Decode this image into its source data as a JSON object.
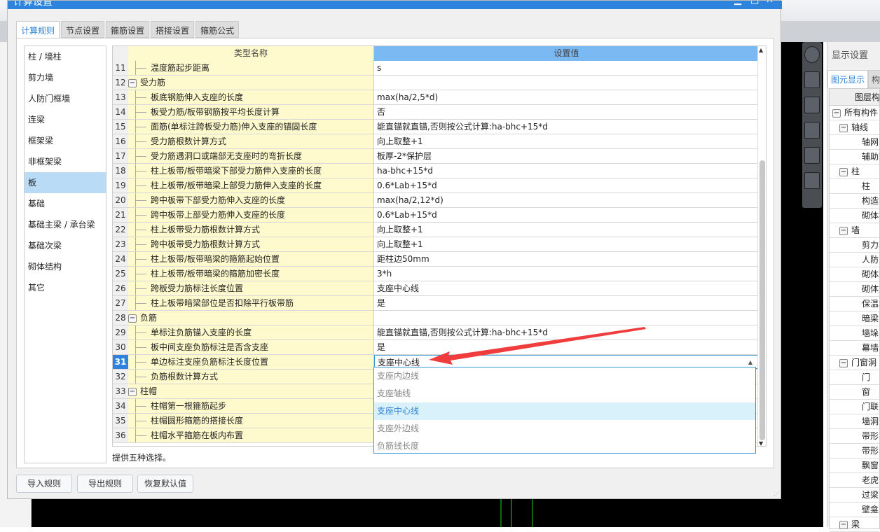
{
  "dialog": {
    "title": "计算设置",
    "tabs": [
      "计算规则",
      "节点设置",
      "箍筋设置",
      "搭接设置",
      "箍筋公式"
    ],
    "active_tab": 0
  },
  "categories": [
    "柱 / 墙柱",
    "剪力墙",
    "人防门框墙",
    "连梁",
    "框架梁",
    "非框架梁",
    "板",
    "基础",
    "基础主梁 / 承台梁",
    "基础次梁",
    "砌体结构",
    "其它"
  ],
  "selected_category": "板",
  "grid": {
    "headers": {
      "name": "类型名称",
      "value": "设置值"
    },
    "rows": [
      {
        "num": "11",
        "name": "温度筋起步距离",
        "value": "s",
        "type": "child"
      },
      {
        "num": "12",
        "name": "受力筋",
        "value": "",
        "type": "group"
      },
      {
        "num": "13",
        "name": "板底钢筋伸入支座的长度",
        "value": "max(ha/2,5*d)",
        "type": "child"
      },
      {
        "num": "14",
        "name": "板受力筋/板带钢筋按平均长度计算",
        "value": "否",
        "type": "child"
      },
      {
        "num": "15",
        "name": "面筋(单标注跨板受力筋)伸入支座的锚固长度",
        "value": "能直锚就直锚,否则按公式计算:ha-bhc+15*d",
        "type": "child"
      },
      {
        "num": "16",
        "name": "受力筋根数计算方式",
        "value": "向上取整+1",
        "type": "child"
      },
      {
        "num": "17",
        "name": "受力筋遇洞口或端部无支座时的弯折长度",
        "value": "板厚-2*保护层",
        "type": "child"
      },
      {
        "num": "18",
        "name": "柱上板带/板带暗梁下部受力筋伸入支座的长度",
        "value": "ha-bhc+15*d",
        "type": "child"
      },
      {
        "num": "19",
        "name": "柱上板带/板带暗梁上部受力筋伸入支座的长度",
        "value": "0.6*Lab+15*d",
        "type": "child"
      },
      {
        "num": "20",
        "name": "跨中板带下部受力筋伸入支座的长度",
        "value": "max(ha/2,12*d)",
        "type": "child"
      },
      {
        "num": "21",
        "name": "跨中板带上部受力筋伸入支座的长度",
        "value": "0.6*Lab+15*d",
        "type": "child"
      },
      {
        "num": "22",
        "name": "柱上板带受力筋根数计算方式",
        "value": "向上取整+1",
        "type": "child"
      },
      {
        "num": "23",
        "name": "跨中板带受力筋根数计算方式",
        "value": "向上取整+1",
        "type": "child"
      },
      {
        "num": "24",
        "name": "柱上板带/板带暗梁的箍筋起始位置",
        "value": "距柱边50mm",
        "type": "child"
      },
      {
        "num": "25",
        "name": "柱上板带/板带暗梁的箍筋加密长度",
        "value": "3*h",
        "type": "child"
      },
      {
        "num": "26",
        "name": "跨板受力筋标注长度位置",
        "value": "支座中心线",
        "type": "child"
      },
      {
        "num": "27",
        "name": "柱上板带暗梁部位是否扣除平行板带筋",
        "value": "是",
        "type": "child"
      },
      {
        "num": "28",
        "name": "负筋",
        "value": "",
        "type": "group"
      },
      {
        "num": "29",
        "name": "单标注负筋锚入支座的长度",
        "value": "能直锚就直锚,否则按公式计算:ha-bhc+15*d",
        "type": "child"
      },
      {
        "num": "30",
        "name": "板中间支座负筋标注是否含支座",
        "value": "是",
        "type": "child"
      },
      {
        "num": "31",
        "name": "单边标注支座负筋标注长度位置",
        "value": "支座中心线",
        "type": "child",
        "selected": true
      },
      {
        "num": "32",
        "name": "负筋根数计算方式",
        "value": "",
        "type": "child"
      },
      {
        "num": "33",
        "name": "柱帽",
        "value": "",
        "type": "group"
      },
      {
        "num": "34",
        "name": "柱帽第一根箍筋起步",
        "value": "",
        "type": "child"
      },
      {
        "num": "35",
        "name": "柱帽圆形箍筋的搭接长度",
        "value": "",
        "type": "child"
      },
      {
        "num": "36",
        "name": "柱帽水平箍筋在板内布置",
        "value": "",
        "type": "child"
      }
    ]
  },
  "dropdown": {
    "options": [
      "支座内边线",
      "支座轴线",
      "支座中心线",
      "支座外边线",
      "负筋线长度"
    ],
    "selected": "支座中心线"
  },
  "hint": "提供五种选择。",
  "buttons": {
    "import": "导入规则",
    "export": "导出规则",
    "reset": "恢复默认值"
  },
  "right_panel": {
    "title": "显示设置",
    "tabs": [
      "图元显示",
      "构"
    ],
    "header": "图层构件",
    "tree": [
      {
        "label": "所有构件",
        "level": 0,
        "group": true
      },
      {
        "label": "轴线",
        "level": 1,
        "group": true
      },
      {
        "label": "轴网",
        "level": 2
      },
      {
        "label": "辅助轴线",
        "level": 2
      },
      {
        "label": "柱",
        "level": 1,
        "group": true
      },
      {
        "label": "柱",
        "level": 2
      },
      {
        "label": "构造柱",
        "level": 2
      },
      {
        "label": "砌体柱",
        "level": 2
      },
      {
        "label": "墙",
        "level": 1,
        "group": true
      },
      {
        "label": "剪力墙",
        "level": 2
      },
      {
        "label": "人防门框墙",
        "level": 2
      },
      {
        "label": "砌体墙",
        "level": 2
      },
      {
        "label": "砌体加筋",
        "level": 2
      },
      {
        "label": "保温墙",
        "level": 2
      },
      {
        "label": "暗梁",
        "level": 2
      },
      {
        "label": "墙垛",
        "level": 2
      },
      {
        "label": "幕墙",
        "level": 2
      },
      {
        "label": "门窗洞",
        "level": 1,
        "group": true
      },
      {
        "label": "门",
        "level": 2
      },
      {
        "label": "窗",
        "level": 2
      },
      {
        "label": "门联窗",
        "level": 2
      },
      {
        "label": "墙洞",
        "level": 2
      },
      {
        "label": "带形窗",
        "level": 2
      },
      {
        "label": "带形洞",
        "level": 2
      },
      {
        "label": "飘窗",
        "level": 2
      },
      {
        "label": "老虎窗",
        "level": 2
      },
      {
        "label": "过梁",
        "level": 2
      },
      {
        "label": "壁龛",
        "level": 2
      },
      {
        "label": "梁",
        "level": 1,
        "group": true
      }
    ]
  },
  "toolbar_icons": [
    "orbit-icon",
    "3d-view-icon",
    "wireframe-icon",
    "solid-view-icon",
    "rotate-icon",
    "checklist-icon"
  ],
  "colors": {
    "accent": "#2e84dc",
    "header_value": "#7bb9f3",
    "name_column": "#fffacd",
    "annotation_arrow": "#f03c3c"
  }
}
